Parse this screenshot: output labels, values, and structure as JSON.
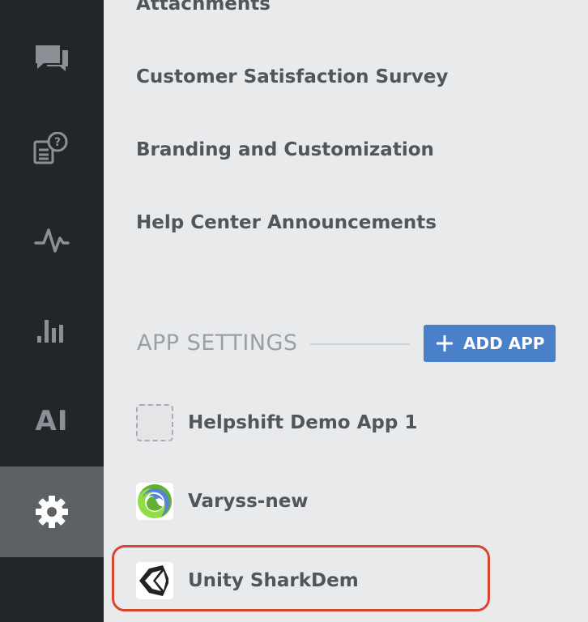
{
  "sidebar": {
    "items": [
      {
        "name": "conversations",
        "icon": "chat-bubbles-icon"
      },
      {
        "name": "faqs",
        "icon": "faq-document-icon"
      },
      {
        "name": "activity",
        "icon": "pulse-icon"
      },
      {
        "name": "analytics",
        "icon": "bar-chart-icon"
      },
      {
        "name": "ai",
        "label": "AI"
      },
      {
        "name": "settings",
        "icon": "gear-icon",
        "active": true
      }
    ]
  },
  "settings_menu": {
    "items": [
      "Attachments",
      "Customer Satisfaction Survey",
      "Branding and Customization",
      "Help Center Announcements"
    ]
  },
  "app_settings": {
    "title": "APP SETTINGS",
    "add_app_label": "ADD APP",
    "apps": [
      {
        "name": "Helpshift Demo App 1",
        "icon": "placeholder-icon"
      },
      {
        "name": "Varyss-new",
        "icon": "clojure-logo-icon"
      },
      {
        "name": "Unity SharkDem",
        "icon": "unity-logo-icon",
        "highlighted": true
      }
    ]
  },
  "colors": {
    "sidebar_bg": "#222629",
    "sidebar_active": "#5b6165",
    "main_bg": "#e9eaeb",
    "accent": "#4a7fca",
    "highlight": "#d9452f",
    "text": "#50565c"
  }
}
